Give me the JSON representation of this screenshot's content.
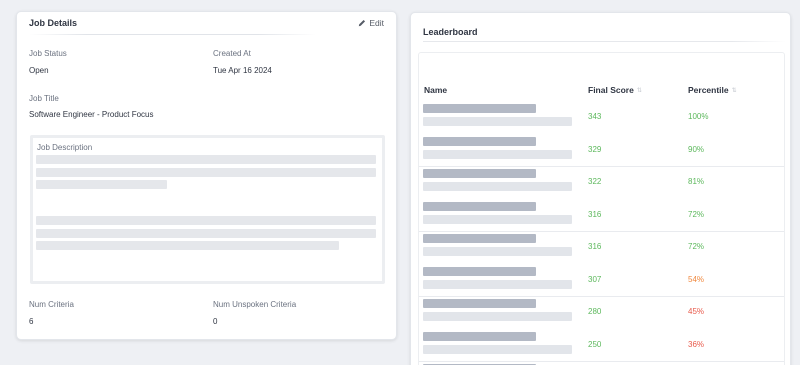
{
  "job_details": {
    "title": "Job Details",
    "edit_label": "Edit",
    "status_label": "Job Status",
    "status_value": "Open",
    "created_label": "Created At",
    "created_value": "Tue Apr 16 2024",
    "job_title_label": "Job Title",
    "job_title_value": "Software Engineer - Product Focus",
    "description_label": "Job Description",
    "num_criteria_label": "Num Criteria",
    "num_criteria_value": "6",
    "num_unspoken_label": "Num Unspoken Criteria",
    "num_unspoken_value": "0"
  },
  "leaderboard": {
    "title": "Leaderboard",
    "columns": [
      "Name",
      "Final Score",
      "Percentile"
    ],
    "rows": [
      {
        "score": "343",
        "percentile": "100%",
        "score_color": "#5cb85c",
        "pct_color": "#5cb85c"
      },
      {
        "score": "329",
        "percentile": "90%",
        "score_color": "#5cb85c",
        "pct_color": "#5cb85c"
      },
      {
        "score": "322",
        "percentile": "81%",
        "score_color": "#5cb85c",
        "pct_color": "#5cb85c"
      },
      {
        "score": "316",
        "percentile": "72%",
        "score_color": "#5cb85c",
        "pct_color": "#5cb85c"
      },
      {
        "score": "316",
        "percentile": "72%",
        "score_color": "#5cb85c",
        "pct_color": "#5cb85c"
      },
      {
        "score": "307",
        "percentile": "54%",
        "score_color": "#5cb85c",
        "pct_color": "#f0883e"
      },
      {
        "score": "280",
        "percentile": "45%",
        "score_color": "#5cb85c",
        "pct_color": "#e8594a"
      },
      {
        "score": "250",
        "percentile": "36%",
        "score_color": "#5cb85c",
        "pct_color": "#e8594a"
      }
    ]
  },
  "icons": {
    "edit": "pencil-icon",
    "sort": "sort-icon"
  },
  "colors": {
    "page_bg": "#eef0f4",
    "good": "#5cb85c",
    "medium": "#f0883e",
    "bad": "#e8594a"
  }
}
